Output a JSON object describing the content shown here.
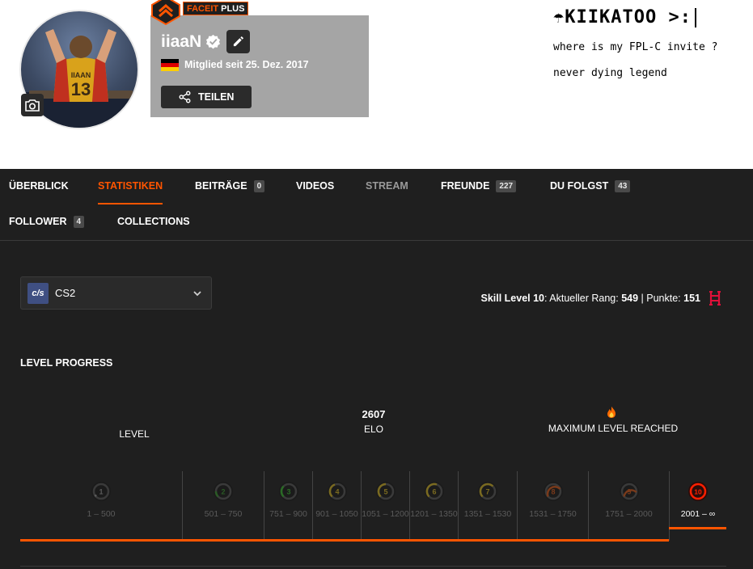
{
  "profile": {
    "nickname": "iiaaN",
    "member_since": "Mitglied seit 25. Dez. 2017",
    "share_label": "TEILEN",
    "subscription_prefix": "FACEIT",
    "subscription_tier": "PLUS",
    "country": "Germany",
    "avatar_jersey_name": "IIAAN",
    "avatar_jersey_number": "13"
  },
  "bio": {
    "title": "☂KIIKATOO >:",
    "line1": "where is my FPL-C invite ?",
    "line2": "never dying legend"
  },
  "nav": {
    "items": [
      {
        "label": "ÜBERBLICK"
      },
      {
        "label": "STATISTIKEN",
        "active": true
      },
      {
        "label": "BEITRÄGE",
        "count": "0"
      },
      {
        "label": "VIDEOS"
      },
      {
        "label": "STREAM"
      },
      {
        "label": "FREUNDE",
        "count": "227"
      },
      {
        "label": "DU FOLGST",
        "count": "43"
      },
      {
        "label": "FOLLOWER",
        "count": "4"
      },
      {
        "label": "COLLECTIONS"
      }
    ]
  },
  "game_select": {
    "logo_text": "c/s",
    "value": "CS2"
  },
  "skill": {
    "prefix": "Skill Level 10",
    "rank_label": ": Aktueller Rang: ",
    "rank": "549",
    "sep": " | Punkte: ",
    "points": "151"
  },
  "level_progress": {
    "title": "LEVEL PROGRESS",
    "level_label": "LEVEL",
    "elo_value": "2607",
    "elo_label": "ELO",
    "max_label": "MAXIMUM LEVEL REACHED",
    "current_level": 10,
    "levels": [
      {
        "num": "1",
        "range": "1 – 500",
        "color": "#e5e5e5"
      },
      {
        "num": "2",
        "range": "501 – 750",
        "color": "#1ce400"
      },
      {
        "num": "3",
        "range": "751 – 900",
        "color": "#1ce400"
      },
      {
        "num": "4",
        "range": "901 – 1050",
        "color": "#ffc800"
      },
      {
        "num": "5",
        "range": "1051 – 1200",
        "color": "#ffc800"
      },
      {
        "num": "6",
        "range": "1201 – 1350",
        "color": "#ffc800"
      },
      {
        "num": "7",
        "range": "1351 – 1530",
        "color": "#ffc800"
      },
      {
        "num": "8",
        "range": "1531 – 1750",
        "color": "#ff6309"
      },
      {
        "num": "9",
        "range": "1751 – 2000",
        "color": "#ff6309"
      },
      {
        "num": "10",
        "range": "2001 – ∞",
        "color": "#fe1f00"
      }
    ]
  },
  "colors": {
    "accent": "#ff5500",
    "dark_bg": "#1f1f1f",
    "profile_box": "#a5a5a5"
  }
}
